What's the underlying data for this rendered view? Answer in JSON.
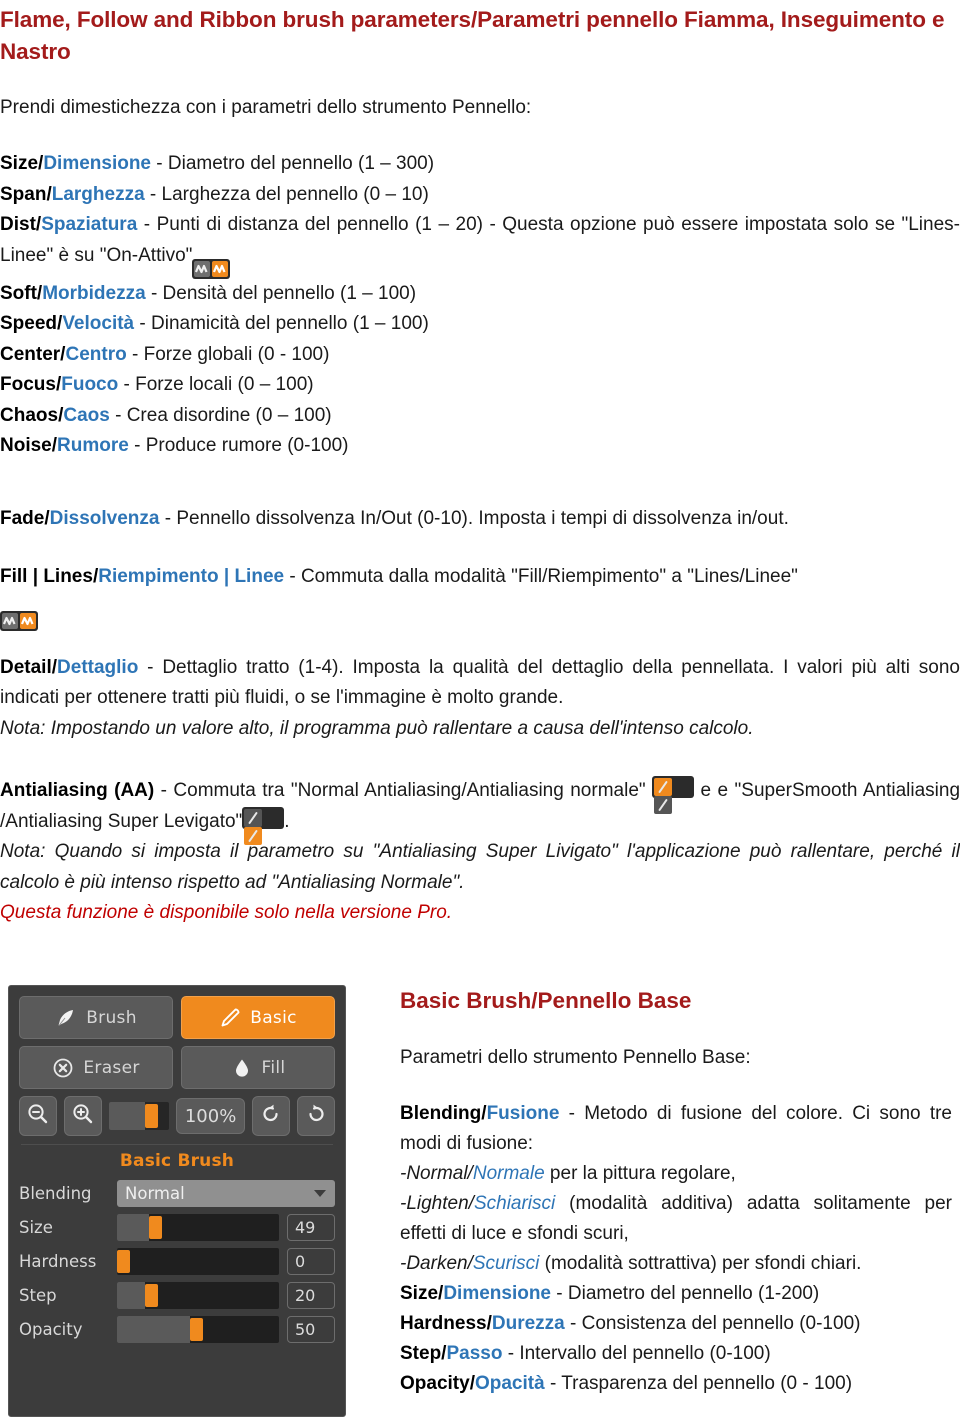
{
  "colors": {
    "heading_red": "#a31b1b",
    "term_blue": "#2e75b6",
    "accent_orange": "#f08a1e",
    "panel_bg": "#3c3c3c",
    "note_red": "#c00000"
  },
  "title": "Flame, Follow and Ribbon brush parameters/Parametri pennello Fiamma, Inseguimento e Nastro",
  "intro": "Prendi dimestichezza con i parametri dello strumento Pennello:",
  "parameters": [
    {
      "en": "Size/",
      "it": "Dimensione",
      "desc": " - Diametro del pennello (1 – 300)"
    },
    {
      "en": "Span/",
      "it": "Larghezza",
      "desc": " - Larghezza del pennello (0 – 10)"
    },
    {
      "en": "Dist/",
      "it": "Spaziatura",
      "desc": " - Punti di distanza del pennello (1 – 20) - Questa opzione può essere impostata solo se \"Lines-Linee\" è su \"On-Attivo\"",
      "icon": "fill-lines-toggle-icon"
    },
    {
      "en": "Soft/",
      "it": "Morbidezza",
      "desc": " - Densità del pennello (1 – 100)"
    },
    {
      "en": "Speed/",
      "it": "Velocità",
      "desc": " - Dinamicità del pennello (1 – 100)"
    },
    {
      "en": "Center/",
      "it": "Centro",
      "desc": " - Forze globali (0 - 100)"
    },
    {
      "en": "Focus/",
      "it": "Fuoco",
      "desc": " - Forze locali (0 – 100)"
    },
    {
      "en": "Chaos/",
      "it": "Caos",
      "desc": " - Crea disordine (0 – 100)"
    },
    {
      "en": "Noise/",
      "it": "Rumore",
      "desc": " - Produce rumore (0-100)"
    }
  ],
  "fade": {
    "en": "Fade/",
    "it": "Dissolvenza",
    "desc": " - Pennello dissolvenza In/Out (0-10). Imposta i tempi di dissolvenza in/out."
  },
  "fill_lines": {
    "en_a": "Fill | Lines/",
    "it_a": "Riempimento | Linee",
    "desc": " - Commuta dalla modalità \"Fill/Riempimento\" a \"Lines/Linee\"",
    "icon": "fill-lines-toggle-icon"
  },
  "detail": {
    "en": "Detail/",
    "it": "Dettaglio",
    "desc": " - Dettaglio tratto (1-4). Imposta la qualità del dettaglio della pennellata. I valori più alti sono indicati per ottenere tratti più fluidi, o se l'immagine è molto grande.",
    "note": "Nota: Impostando un valore alto, il programma può rallentare a causa dell'intenso calcolo."
  },
  "antialiasing": {
    "label": "Antialiasing (AA)",
    "desc_1": " - Commuta tra \"Normal Antialiasing/Antialiasing normale\" ",
    "desc_mid": " e \"SuperSmooth Antialiasing /Antialiasing Super Levigato\"",
    "desc_end": ".",
    "note": "Nota: Quando si imposta il parametro su \"Antialiasing Super Livigato\" l'applicazione può rallentare, perché il calcolo è più intenso rispetto ad \"Antialiasing Normale\".",
    "pro_note": "Questa funzione è disponibile solo nella versione Pro.",
    "icon_normal": "antialias-normal-icon",
    "icon_supersmooth": "antialias-supersmooth-icon"
  },
  "panel": {
    "tools": [
      {
        "label": "Brush",
        "icon": "feather-icon",
        "active": false
      },
      {
        "label": "Basic",
        "icon": "pencil-icon",
        "active": true
      },
      {
        "label": "Eraser",
        "icon": "eraser-circle-x-icon",
        "active": false
      },
      {
        "label": "Fill",
        "icon": "droplet-icon",
        "active": false
      }
    ],
    "zoom_out_icon": "zoom-out-icon",
    "zoom_in_icon": "zoom-in-icon",
    "zoom_value": "100%",
    "undo_icon": "undo-icon",
    "redo_icon": "redo-icon",
    "section_title": "Basic Brush",
    "blending_label": "Blending",
    "blending_value": "Normal",
    "sliders": [
      {
        "label": "Size",
        "value": "49",
        "pct": 20
      },
      {
        "label": "Hardness",
        "value": "0",
        "pct": 0
      },
      {
        "label": "Step",
        "value": "20",
        "pct": 17
      },
      {
        "label": "Opacity",
        "value": "50",
        "pct": 45
      }
    ]
  },
  "basic_brush": {
    "title": "Basic Brush/Pennello Base",
    "subtitle": "Parametri dello strumento Pennello Base:",
    "blending": {
      "en": "Blending/",
      "it": "Fusione",
      "desc": " - Metodo di fusione del colore. Ci sono tre modi di fusione:"
    },
    "modes": [
      {
        "en": "-Normal/",
        "it": "Normale",
        "desc": " per la pittura regolare,"
      },
      {
        "en": "-Lighten/",
        "it": "Schiarisci",
        "desc": " (modalità additiva) adatta solitamente per effetti di luce e sfondi scuri,"
      },
      {
        "en": "-Darken/",
        "it": "Scurisci",
        "desc": " (modalità sottrattiva) per sfondi chiari."
      }
    ],
    "params": [
      {
        "en": "Size/",
        "it": "Dimensione",
        "desc": " - Diametro del pennello (1-200)"
      },
      {
        "en": "Hardness/",
        "it": "Durezza",
        "desc": " - Consistenza del pennello (0-100)"
      },
      {
        "en": "Step/",
        "it": "Passo",
        "desc": " - Intervallo del pennello (0-100)"
      },
      {
        "en": "Opacity/",
        "it": "Opacità",
        "desc": " - Trasparenza del pennello (0 - 100)"
      }
    ]
  }
}
